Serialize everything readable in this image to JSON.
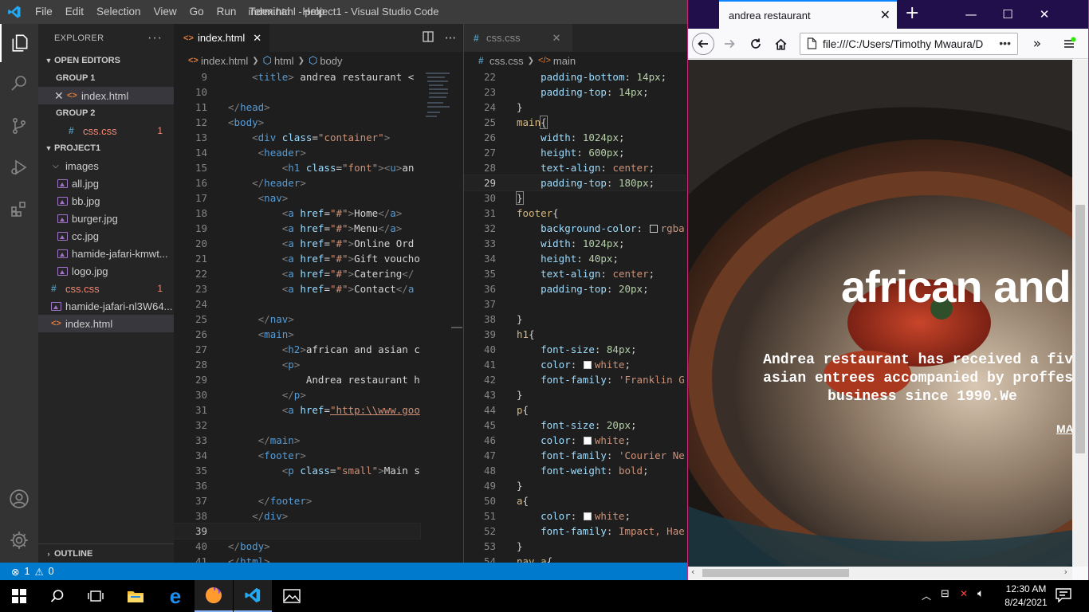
{
  "vscode": {
    "menu": [
      "File",
      "Edit",
      "Selection",
      "View",
      "Go",
      "Run",
      "Terminal",
      "Help"
    ],
    "window_title": "index.html - project1 - Visual Studio Code",
    "explorer": {
      "title": "EXPLORER",
      "open_editors_label": "OPEN EDITORS",
      "group1_label": "GROUP 1",
      "group1_file": "index.html",
      "group2_label": "GROUP 2",
      "group2_file": "css.css",
      "group2_badge": "1",
      "project_label": "PROJECT1",
      "images_folder": "images",
      "images": [
        "all.jpg",
        "bb.jpg",
        "burger.jpg",
        "cc.jpg",
        "hamide-jafari-kmwt...",
        "logo.jpg"
      ],
      "root_css": "css.css",
      "root_css_badge": "1",
      "root_img": "hamide-jafari-nl3W64...",
      "root_html": "index.html",
      "outline_label": "OUTLINE"
    },
    "left_editor": {
      "tab": "index.html",
      "breadcrumb": [
        "index.html",
        "html",
        "body"
      ],
      "lines": [
        {
          "n": "9",
          "html": "    <span class='br'>&lt;</span><span class='tg'>title</span><span class='br'>&gt;</span><span class='tx'> andrea restaurant &lt;</span>"
        },
        {
          "n": "10",
          "html": ""
        },
        {
          "n": "11",
          "html": "<span class='br'>&lt;/</span><span class='tg'>head</span><span class='br'>&gt;</span>"
        },
        {
          "n": "12",
          "html": "<span class='br'>&lt;</span><span class='tg'>body</span><span class='br'>&gt;</span>"
        },
        {
          "n": "13",
          "html": "    <span class='br'>&lt;</span><span class='tg'>div</span> <span class='at'>class</span><span class='tx'>=</span><span class='st'>\"container\"</span><span class='br'>&gt;</span>"
        },
        {
          "n": "14",
          "html": "     <span class='br'>&lt;</span><span class='tg'>header</span><span class='br'>&gt;</span>"
        },
        {
          "n": "15",
          "html": "         <span class='br'>&lt;</span><span class='tg'>h1</span> <span class='at'>class</span><span class='tx'>=</span><span class='st'>\"font\"</span><span class='br'>&gt;&lt;</span><span class='tg'>u</span><span class='br'>&gt;</span><span class='tx'>an</span>"
        },
        {
          "n": "16",
          "html": "    <span class='br'>&lt;/</span><span class='tg'>header</span><span class='br'>&gt;</span>"
        },
        {
          "n": "17",
          "html": "     <span class='br'>&lt;</span><span class='tg'>nav</span><span class='br'>&gt;</span>"
        },
        {
          "n": "18",
          "html": "         <span class='br'>&lt;</span><span class='tg'>a</span> <span class='at'>href</span><span class='tx'>=</span><span class='st'>\"#\"</span><span class='br'>&gt;</span><span class='tx'>Home</span><span class='br'>&lt;/</span><span class='tg'>a</span><span class='br'>&gt;</span>"
        },
        {
          "n": "19",
          "html": "         <span class='br'>&lt;</span><span class='tg'>a</span> <span class='at'>href</span><span class='tx'>=</span><span class='st'>\"#\"</span><span class='br'>&gt;</span><span class='tx'>Menu</span><span class='br'>&lt;/</span><span class='tg'>a</span><span class='br'>&gt;</span>"
        },
        {
          "n": "20",
          "html": "         <span class='br'>&lt;</span><span class='tg'>a</span> <span class='at'>href</span><span class='tx'>=</span><span class='st'>\"#\"</span><span class='br'>&gt;</span><span class='tx'>Online Ord</span>"
        },
        {
          "n": "21",
          "html": "         <span class='br'>&lt;</span><span class='tg'>a</span> <span class='at'>href</span><span class='tx'>=</span><span class='st'>\"#\"</span><span class='br'>&gt;</span><span class='tx'>Gift voucho</span>"
        },
        {
          "n": "22",
          "html": "         <span class='br'>&lt;</span><span class='tg'>a</span> <span class='at'>href</span><span class='tx'>=</span><span class='st'>\"#\"</span><span class='br'>&gt;</span><span class='tx'>Catering</span><span class='br'>&lt;/</span>"
        },
        {
          "n": "23",
          "html": "         <span class='br'>&lt;</span><span class='tg'>a</span> <span class='at'>href</span><span class='tx'>=</span><span class='st'>\"#\"</span><span class='br'>&gt;</span><span class='tx'>Contact</span><span class='br'>&lt;/</span><span class='tg'>a</span>"
        },
        {
          "n": "24",
          "html": ""
        },
        {
          "n": "25",
          "html": "     <span class='br'>&lt;/</span><span class='tg'>nav</span><span class='br'>&gt;</span>"
        },
        {
          "n": "26",
          "html": "     <span class='br'>&lt;</span><span class='tg'>main</span><span class='br'>&gt;</span>"
        },
        {
          "n": "27",
          "html": "         <span class='br'>&lt;</span><span class='tg'>h2</span><span class='br'>&gt;</span><span class='tx'>african and asian c</span>"
        },
        {
          "n": "28",
          "html": "         <span class='br'>&lt;</span><span class='tg'>p</span><span class='br'>&gt;</span>"
        },
        {
          "n": "29",
          "html": "             <span class='tx'>Andrea restaurant h</span>"
        },
        {
          "n": "30",
          "html": "         <span class='br'>&lt;/</span><span class='tg'>p</span><span class='br'>&gt;</span>"
        },
        {
          "n": "31",
          "html": "         <span class='br'>&lt;</span><span class='tg'>a</span> <span class='at'>href</span><span class='tx'>=</span><span class='st' style='text-decoration:underline'>\"http:\\\\www.goo</span>"
        },
        {
          "n": "32",
          "html": ""
        },
        {
          "n": "33",
          "html": "     <span class='br'>&lt;/</span><span class='tg'>main</span><span class='br'>&gt;</span>"
        },
        {
          "n": "34",
          "html": "     <span class='br'>&lt;</span><span class='tg'>footer</span><span class='br'>&gt;</span>"
        },
        {
          "n": "35",
          "html": "         <span class='br'>&lt;</span><span class='tg'>p</span> <span class='at'>class</span><span class='tx'>=</span><span class='st'>\"small\"</span><span class='br'>&gt;</span><span class='tx'>Main s</span>"
        },
        {
          "n": "36",
          "html": ""
        },
        {
          "n": "37",
          "html": "     <span class='br'>&lt;/</span><span class='tg'>footer</span><span class='br'>&gt;</span>"
        },
        {
          "n": "38",
          "html": "    <span class='br'>&lt;/</span><span class='tg'>div</span><span class='br'>&gt;</span>"
        },
        {
          "n": "39",
          "html": "",
          "current": true
        },
        {
          "n": "40",
          "html": "<span class='br'>&lt;/</span><span class='tg'>body</span><span class='br'>&gt;</span>"
        },
        {
          "n": "41",
          "html": "<span class='br'>&lt;/</span><span class='tg'>html</span><span class='br'>&gt;</span>"
        }
      ]
    },
    "right_editor": {
      "tab": "css.css",
      "breadcrumb": [
        "css.css",
        "main"
      ],
      "lines": [
        {
          "n": "22",
          "html": "    <span class='pr'>padding-bottom</span><span class='pn'>: </span><span class='nm'>14px</span><span class='pn'>;</span>"
        },
        {
          "n": "23",
          "html": "    <span class='pr'>padding-top</span><span class='pn'>: </span><span class='nm'>14px</span><span class='pn'>;</span>"
        },
        {
          "n": "24",
          "html": "<span class='pn'>}</span>"
        },
        {
          "n": "25",
          "html": "<span class='sel-c'>main</span><span class='pn' style='outline:1px solid #888'>{</span>"
        },
        {
          "n": "26",
          "html": "    <span class='pr'>width</span><span class='pn'>: </span><span class='nm'>1024px</span><span class='pn'>;</span>"
        },
        {
          "n": "27",
          "html": "    <span class='pr'>height</span><span class='pn'>: </span><span class='nm'>600px</span><span class='pn'>;</span>"
        },
        {
          "n": "28",
          "html": "    <span class='pr'>text-align</span><span class='pn'>: </span><span class='vl'>center</span><span class='pn'>;</span>"
        },
        {
          "n": "29",
          "html": "    <span class='pr'>padding-top</span><span class='pn'>: </span><span class='nm'>180px</span><span class='pn'>;</span>",
          "current": true
        },
        {
          "n": "30",
          "html": "<span class='pn' style='outline:1px solid #888'>}</span>"
        },
        {
          "n": "31",
          "html": "<span class='sel-c'>footer</span><span class='pn'>{</span>"
        },
        {
          "n": "32",
          "html": "    <span class='pr'>background-color</span><span class='pn'>: </span><span class='swatch' style='background:transparent'></span><span class='vl'>rgba</span>"
        },
        {
          "n": "33",
          "html": "    <span class='pr'>width</span><span class='pn'>: </span><span class='nm'>1024px</span><span class='pn'>;</span>"
        },
        {
          "n": "34",
          "html": "    <span class='pr'>height</span><span class='pn'>: </span><span class='nm'>40px</span><span class='pn'>;</span>"
        },
        {
          "n": "35",
          "html": "    <span class='pr'>text-align</span><span class='pn'>: </span><span class='vl'>center</span><span class='pn'>;</span>"
        },
        {
          "n": "36",
          "html": "    <span class='pr'>padding-top</span><span class='pn'>: </span><span class='nm'>20px</span><span class='pn'>;</span>"
        },
        {
          "n": "37",
          "html": ""
        },
        {
          "n": "38",
          "html": "<span class='pn'>}</span>"
        },
        {
          "n": "39",
          "html": "<span class='sel-c'>h1</span><span class='pn'>{</span>"
        },
        {
          "n": "40",
          "html": "    <span class='pr'>font-size</span><span class='pn'>: </span><span class='nm'>84px</span><span class='pn'>;</span>"
        },
        {
          "n": "41",
          "html": "    <span class='pr'>color</span><span class='pn'>: </span><span class='swatch' style='background:#fff'></span><span class='vl'>white</span><span class='pn'>;</span>"
        },
        {
          "n": "42",
          "html": "    <span class='pr'>font-family</span><span class='pn'>: </span><span class='vl'>'Franklin G</span>"
        },
        {
          "n": "43",
          "html": "<span class='pn'>}</span>"
        },
        {
          "n": "44",
          "html": "<span class='sel-c'>p</span><span class='pn'>{</span>"
        },
        {
          "n": "45",
          "html": "    <span class='pr'>font-size</span><span class='pn'>: </span><span class='nm'>20px</span><span class='pn'>;</span>"
        },
        {
          "n": "46",
          "html": "    <span class='pr'>color</span><span class='pn'>: </span><span class='swatch' style='background:#fff'></span><span class='vl'>white</span><span class='pn'>;</span>"
        },
        {
          "n": "47",
          "html": "    <span class='pr'>font-family</span><span class='pn'>: </span><span class='vl'>'Courier Ne</span>"
        },
        {
          "n": "48",
          "html": "    <span class='pr'>font-weight</span><span class='pn'>: </span><span class='vl'>bold</span><span class='pn'>;</span>"
        },
        {
          "n": "49",
          "html": "<span class='pn'>}</span>"
        },
        {
          "n": "50",
          "html": "<span class='sel-c'>a</span><span class='pn'>{</span>"
        },
        {
          "n": "51",
          "html": "    <span class='pr'>color</span><span class='pn'>: </span><span class='swatch' style='background:#fff'></span><span class='vl'>white</span><span class='pn'>;</span>"
        },
        {
          "n": "52",
          "html": "    <span class='pr'>font-family</span><span class='pn'>: </span><span class='vl'>Impact, Hae</span>"
        },
        {
          "n": "53",
          "html": "<span class='pn'>}</span>"
        },
        {
          "n": "54",
          "html": "<span class='sel-c'>nav a</span><span class='pn'>{</span>"
        }
      ]
    },
    "status": {
      "errors": "1",
      "warnings": "0"
    }
  },
  "firefox": {
    "tab_title": "andrea restaurant",
    "url": "file:///C:/Users/Timothy Mwaura/D",
    "page": {
      "heading": "african and",
      "paragraph_lines": [
        "Andrea restaurant has received a five",
        "asian entrees accompanied by proffess",
        "business since 1990.We"
      ],
      "link": "MA"
    }
  },
  "taskbar": {
    "time": "12:30 AM",
    "date": "8/24/2021"
  },
  "colors": {
    "vscode_statusbar": "#007acc",
    "firefox_titlebar": "#200f4a",
    "firefox_accent": "#0a84ff"
  }
}
